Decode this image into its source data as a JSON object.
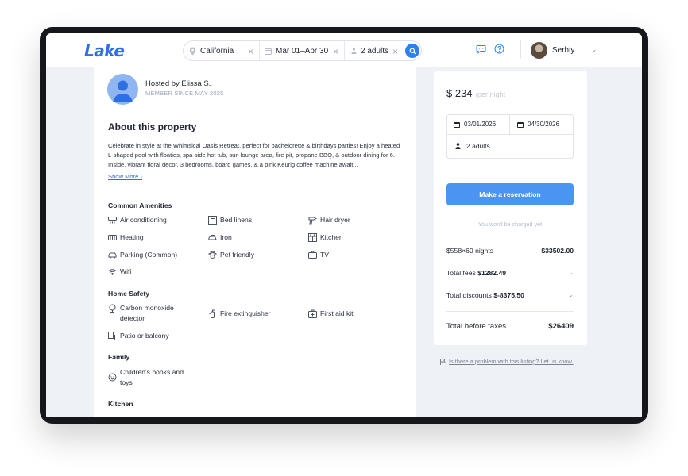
{
  "header": {
    "logo": "Lake",
    "search": {
      "location": "California",
      "dates": "Mar 01–Apr 30",
      "guests": "2 adults"
    },
    "user": {
      "name": "Serhiy"
    }
  },
  "host": {
    "name": "Hosted by Elissa S.",
    "since": "MEMBER SINCE MAY 2025"
  },
  "about": {
    "title": "About this property",
    "text": "Celebrate in style at the Whimsical Oasis Retreat, perfect for bachelorette & birthdays parties! Enjoy a heated L-shaped pool with floaties, spa-side hot tub, sun lounge area, fire pit, propane BBQ, & outdoor dining for 6. Inside, vibrant floral decor, 3 bedrooms, board games, & a pink Keurig coffee machine await...",
    "show_more": "Show More ›"
  },
  "amenities": {
    "common_title": "Common Amenities",
    "common": [
      {
        "label": "Air conditioning",
        "icon": "air-conditioning-icon"
      },
      {
        "label": "Bed linens",
        "icon": "bed-linens-icon"
      },
      {
        "label": "Hair dryer",
        "icon": "hair-dryer-icon"
      },
      {
        "label": "Heating",
        "icon": "heating-icon"
      },
      {
        "label": "Iron",
        "icon": "iron-icon"
      },
      {
        "label": "Kitchen",
        "icon": "kitchen-icon"
      },
      {
        "label": "Parking (Common)",
        "icon": "parking-icon"
      },
      {
        "label": "Pet friendly",
        "icon": "paw-icon"
      },
      {
        "label": "TV",
        "icon": "tv-icon"
      },
      {
        "label": "Wifi",
        "icon": "wifi-icon"
      }
    ],
    "safety_title": "Home Safety",
    "safety": [
      {
        "label": "Carbon monoxide detector",
        "icon": "co-detector-icon"
      },
      {
        "label": "Fire extinguisher",
        "icon": "fire-extinguisher-icon"
      },
      {
        "label": "First aid kit",
        "icon": "first-aid-icon"
      },
      {
        "label": "Patio or balcony",
        "icon": "patio-icon"
      }
    ],
    "family_title": "Family",
    "family": [
      {
        "label": "Children's books and toys",
        "icon": "toys-icon"
      }
    ],
    "kitchen_title": "Kitchen"
  },
  "booking": {
    "price": "$ 234",
    "price_unit": "/per night",
    "check_in": "03/01/2026",
    "check_out": "04/30/2026",
    "guests": "2 adults",
    "reserve_label": "Make a reservation",
    "note": "You won't be charged yet",
    "nights_label": "$558×60 nights",
    "nights_value": "$33502.00",
    "fees_label": "Total fees",
    "fees_value": "$1282.49",
    "discounts_label": "Total discounts",
    "discounts_value": "$-8375.50",
    "total_label": "Total before taxes",
    "total_value": "$26409"
  },
  "report": {
    "text": "Is there a problem with this listing? Let us know."
  },
  "colors": {
    "accent": "#2f80ed",
    "button": "#4b95f0",
    "background": "#eef1f6"
  }
}
